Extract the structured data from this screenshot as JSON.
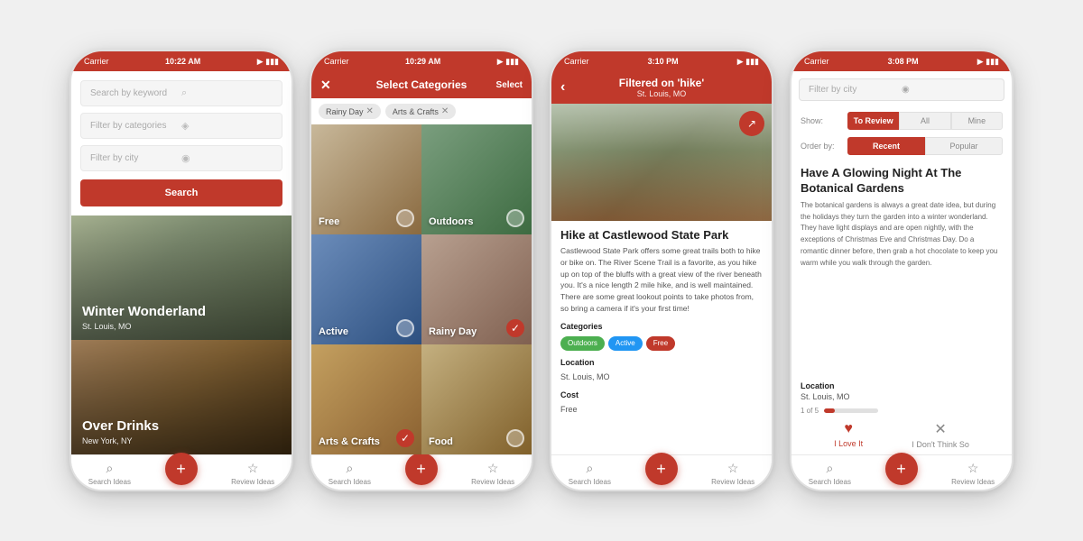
{
  "phones": [
    {
      "id": "phone-search",
      "status": {
        "carrier": "Carrier",
        "time": "10:22 AM",
        "battery": "■"
      },
      "header": null,
      "search": {
        "keyword_placeholder": "Search by keyword",
        "categories_placeholder": "Filter by categories",
        "city_placeholder": "Filter by city",
        "button_label": "Search"
      },
      "hero_cards": [
        {
          "title": "Winter Wonderland",
          "subtitle": "St. Louis, MO"
        },
        {
          "title": "Over Drinks",
          "subtitle": "New York, NY"
        }
      ],
      "nav": [
        "Search Ideas",
        "+",
        "Review Ideas"
      ]
    },
    {
      "id": "phone-categories",
      "status": {
        "carrier": "Carrier",
        "time": "10:29 AM",
        "battery": "■"
      },
      "header": {
        "title": "Select Categories",
        "action": "Select",
        "has_close": true
      },
      "chips": [
        "Rainy Day",
        "Arts & Crafts"
      ],
      "categories": [
        {
          "label": "Free",
          "key": "free",
          "checked": false
        },
        {
          "label": "Outdoors",
          "key": "outdoors",
          "checked": false
        },
        {
          "label": "Active",
          "key": "active",
          "checked": false
        },
        {
          "label": "Rainy Day",
          "key": "rainy",
          "checked": false
        },
        {
          "label": "Arts & Crafts",
          "key": "arts",
          "checked": true
        },
        {
          "label": "Food",
          "key": "food",
          "checked": true
        }
      ],
      "nav": [
        "Search Ideas",
        "+",
        "Review Ideas"
      ]
    },
    {
      "id": "phone-detail",
      "status": {
        "carrier": "Carrier",
        "time": "3:10 PM",
        "battery": "■"
      },
      "header": {
        "title": "Filtered on 'hike'",
        "subtitle": "St. Louis, MO",
        "has_back": true
      },
      "detail": {
        "title": "Hike at Castlewood State Park",
        "description": "Castlewood State Park offers some great trails both to hike or bike on. The River Scene Trail is a favorite, as you hike up on top of the bluffs with a great view of the river beneath you. It's a nice length 2 mile hike, and is well maintained. There are some great lookout points to take photos from, so bring a camera if it's your first time!",
        "categories_label": "Categories",
        "categories": [
          "Outdoors",
          "Active",
          "Free"
        ],
        "location_label": "Location",
        "location": "St. Louis, MO",
        "cost_label": "Cost",
        "cost": "Free"
      },
      "nav": [
        "Search Ideas",
        "+",
        "Review Ideas"
      ]
    },
    {
      "id": "phone-review",
      "status": {
        "carrier": "Carrier",
        "time": "3:08 PM",
        "battery": "■"
      },
      "header": null,
      "filter": {
        "city_placeholder": "Filter by city"
      },
      "show": {
        "label": "Show:",
        "options": [
          "To Review",
          "All",
          "Mine"
        ],
        "active": "To Review"
      },
      "order": {
        "label": "Order by:",
        "options": [
          "Recent",
          "Popular"
        ],
        "active": "Recent"
      },
      "review": {
        "title": "Have A Glowing Night At The Botanical Gardens",
        "body": "The botanical gardens is always a great date idea, but during the holidays they turn the garden into a winter wonderland. They have light displays and are open nightly, with the exceptions of Christmas Eve and Christmas Day. Do a romantic dinner before, then grab a hot chocolate to keep you warm while you walk through the garden.",
        "location_label": "Location",
        "location": "St. Louis, MO",
        "progress": "1 of 5",
        "progress_pct": 20
      },
      "actions": [
        "I Love It",
        "I Don't Think So"
      ],
      "nav": [
        "Search Ideas",
        "+",
        "Review Ideas"
      ]
    }
  ]
}
